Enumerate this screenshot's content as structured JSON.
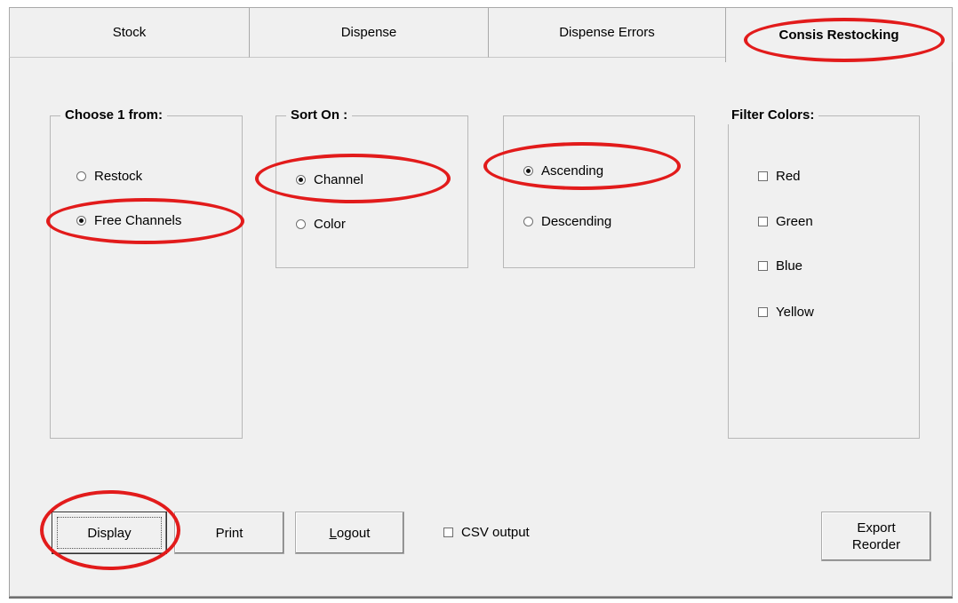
{
  "tabs": [
    {
      "label": "Stock"
    },
    {
      "label": "Dispense"
    },
    {
      "label": "Dispense Errors"
    },
    {
      "label": "Consis Restocking",
      "active": true
    }
  ],
  "choose_group": {
    "title": "Choose 1 from:",
    "options": [
      {
        "label": "Restock",
        "selected": false
      },
      {
        "label": "Free Channels",
        "selected": true
      }
    ]
  },
  "sort_group": {
    "title": "Sort On :",
    "options": [
      {
        "label": "Channel",
        "selected": true
      },
      {
        "label": "Color",
        "selected": false
      }
    ]
  },
  "order_group": {
    "options": [
      {
        "label": "Ascending",
        "selected": true
      },
      {
        "label": "Descending",
        "selected": false
      }
    ]
  },
  "filter_group": {
    "title": "Filter Colors:",
    "options": [
      {
        "label": "Red",
        "checked": false
      },
      {
        "label": "Green",
        "checked": false
      },
      {
        "label": "Blue",
        "checked": false
      },
      {
        "label": "Yellow",
        "checked": false
      }
    ]
  },
  "buttons": {
    "display": "Display",
    "print": "Print",
    "logout_first": "L",
    "logout_rest": "ogout",
    "export_line1": "Export",
    "export_line2": "Reorder"
  },
  "csv_output": {
    "label": "CSV output",
    "checked": false
  },
  "annotation_color": "#e21b1b"
}
